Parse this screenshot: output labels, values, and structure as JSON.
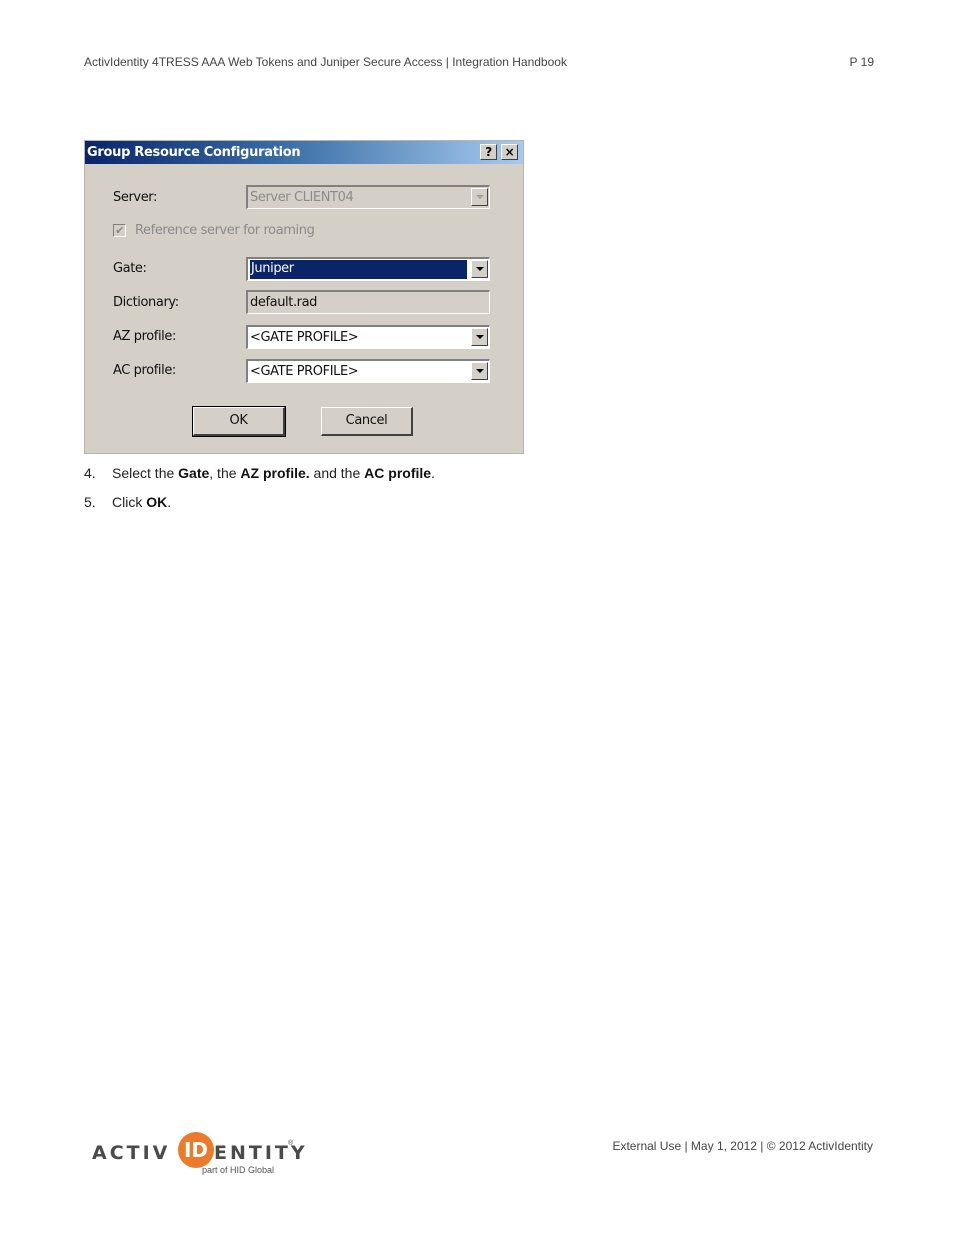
{
  "header": {
    "title": "ActivIdentity 4TRESS AAA Web Tokens and Juniper Secure Access | Integration Handbook",
    "page": "P 19"
  },
  "dialog": {
    "title": "Group Resource Configuration",
    "help_label": "?",
    "close_label": "×",
    "server": {
      "label": "Server:",
      "value": "Server CLIENT04",
      "enabled": false
    },
    "roaming": {
      "label": "Reference server for roaming",
      "checked": true,
      "enabled": false,
      "check_glyph": "✔"
    },
    "gate": {
      "label": "Gate:",
      "value": "Juniper"
    },
    "dictionary": {
      "label": "Dictionary:",
      "value": "default.rad"
    },
    "az_profile": {
      "label": "AZ profile:",
      "value": "<GATE PROFILE>"
    },
    "ac_profile": {
      "label": "AC profile:",
      "value": "<GATE PROFILE>"
    },
    "ok_label": "OK",
    "cancel_label": "Cancel"
  },
  "steps": [
    {
      "num": "4.",
      "parts": [
        "Select the ",
        "Gate",
        ", the ",
        "AZ profile.",
        " and the ",
        "AC profile",
        "."
      ]
    },
    {
      "num": "5.",
      "parts": [
        "Click ",
        "OK",
        "."
      ]
    }
  ],
  "footer": {
    "logo": {
      "left": "ACTIV",
      "mark": "ID",
      "right": "ENTITY",
      "reg": "®",
      "sub": "part of HID Global",
      "accent": "#ec7a2a"
    },
    "text": "External Use | May 1, 2012 | © 2012 ActivIdentity"
  }
}
